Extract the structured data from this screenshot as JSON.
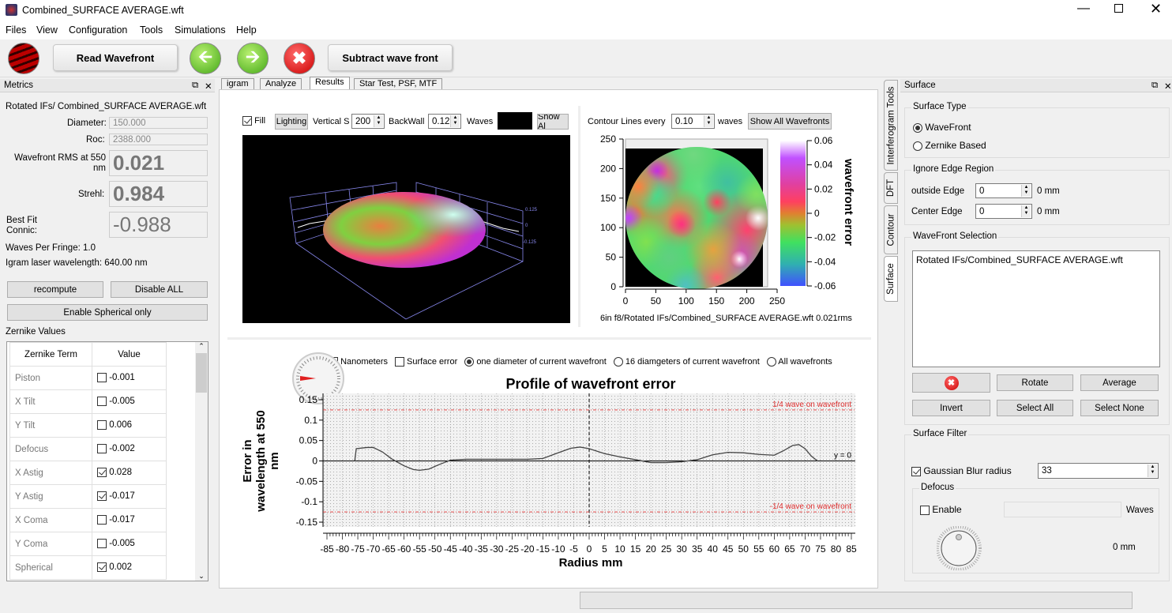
{
  "window": {
    "title": "Combined_SURFACE AVERAGE.wft",
    "controls": [
      "minimize",
      "maximize",
      "close"
    ]
  },
  "menu": [
    "Files",
    "View",
    "Configuration",
    "Tools",
    "Simulations",
    "Help"
  ],
  "toolbar": {
    "read_wavefront": "Read Wavefront",
    "subtract": "Subtract wave front"
  },
  "metrics": {
    "title": "Metrics",
    "file": "Rotated IFs/ Combined_SURFACE AVERAGE.wft",
    "diameter_label": "Diameter:",
    "diameter": "150.000",
    "roc_label": "Roc:",
    "roc": "2388.000",
    "rms_label": "Wavefront RMS at 550 nm",
    "rms": "0.021",
    "strehl_label": "Strehl:",
    "strehl": "0.984",
    "conic_label": "Best Fit Connic:",
    "conic": "-0.988",
    "waves_per_fringe": "Waves Per Fringe: 1.0",
    "laser": "Igram laser wavelength: 640.00 nm",
    "recompute": "recompute",
    "disable_all": "Disable ALL",
    "enable_spherical": "Enable Spherical only",
    "zernike_title": "Zernike Values",
    "zernike_headers": [
      "Zernike Term",
      "Value"
    ],
    "zernike": [
      {
        "term": "Piston",
        "checked": false,
        "value": "-0.001"
      },
      {
        "term": "X Tilt",
        "checked": false,
        "value": "-0.005"
      },
      {
        "term": "Y Tilt",
        "checked": false,
        "value": "0.006"
      },
      {
        "term": "Defocus",
        "checked": false,
        "value": "-0.002"
      },
      {
        "term": "X Astig",
        "checked": true,
        "value": "0.028"
      },
      {
        "term": "Y Astig",
        "checked": true,
        "value": "-0.017"
      },
      {
        "term": "X Coma",
        "checked": false,
        "value": "-0.017"
      },
      {
        "term": "Y Coma",
        "checked": false,
        "value": "-0.005"
      },
      {
        "term": "Spherical",
        "checked": true,
        "value": "0.002"
      }
    ]
  },
  "tabs": [
    "igram",
    "Analyze",
    "Results",
    "Star Test, PSF, MTF"
  ],
  "active_tab": "Results",
  "view3d": {
    "fill_label": "Fill",
    "fill": true,
    "lighting": "Lighting",
    "vertical_label": "Vertical S",
    "vertical": "200",
    "backwall_label": "BackWall",
    "backwall": "0.12",
    "waves_label": "Waves",
    "show_all": "Show Al",
    "axis_labels": [
      "0.125",
      "0",
      "-0.125"
    ]
  },
  "contour": {
    "lines_label": "Contour Lines every",
    "lines": "0.10",
    "waves_label": "waves",
    "show_all": "Show All Wavefronts",
    "x_ticks": [
      "0",
      "50",
      "100",
      "150",
      "200",
      "250"
    ],
    "y_ticks": [
      "0",
      "50",
      "100",
      "150",
      "200",
      "250"
    ],
    "colorbar_ticks": [
      "0.06",
      "0.04",
      "0.02",
      "0",
      "-0.02",
      "-0.04",
      "-0.06"
    ],
    "colorbar_label": "wavefront error",
    "caption": "6in f8/Rotated IFs/Combined_SURFACE AVERAGE.wft  0.021rms"
  },
  "profile": {
    "options": [
      {
        "label": "Nanometers",
        "type": "check",
        "on": false
      },
      {
        "label": "Surface error",
        "type": "check",
        "on": false
      },
      {
        "label": "one diameter of current wavefront",
        "type": "radio",
        "on": true
      },
      {
        "label": "16 diamgeters of current wavefront",
        "type": "radio",
        "on": false
      },
      {
        "label": "All wavefronts",
        "type": "radio",
        "on": false
      }
    ]
  },
  "chart_data": {
    "type": "line",
    "title": "Profile of wavefront error",
    "xlabel": "Radius mm",
    "ylabel": "Error in wavelength at 550 nm",
    "xlim": [
      -85,
      85
    ],
    "ylim": [
      -0.15,
      0.15
    ],
    "x_ticks": [
      "-85",
      "-80",
      "-75",
      "-70",
      "-65",
      "-60",
      "-55",
      "-50",
      "-45",
      "-40",
      "-35",
      "-30",
      "-25",
      "-20",
      "-15",
      "-10",
      "-5",
      "0",
      "5",
      "10",
      "15",
      "20",
      "25",
      "30",
      "35",
      "40",
      "45",
      "50",
      "55",
      "60",
      "65",
      "70",
      "75",
      "80",
      "85"
    ],
    "y_ticks": [
      "0.15",
      "0.1",
      "0.05",
      "0",
      "-0.05",
      "-0.1",
      "-0.15"
    ],
    "grid": true,
    "x": [
      -76,
      -75.5,
      -72,
      -70,
      -67,
      -64,
      -60,
      -57,
      -55,
      -52,
      -49,
      -45,
      -40,
      -30,
      -20,
      -15,
      -10,
      -6,
      -3,
      0,
      5,
      10,
      15,
      20,
      25,
      30,
      35,
      40,
      45,
      50,
      55,
      60,
      63,
      66,
      68,
      70,
      72,
      74
    ],
    "y": [
      0,
      0.03,
      0.033,
      0.033,
      0.022,
      0.005,
      -0.012,
      -0.021,
      -0.023,
      -0.02,
      -0.01,
      0.002,
      0.004,
      0.004,
      0.004,
      0.006,
      0.02,
      0.031,
      0.034,
      0.03,
      0.018,
      0.01,
      0.003,
      -0.004,
      -0.004,
      -0.002,
      0.003,
      0.015,
      0.021,
      0.02,
      0.016,
      0.014,
      0.025,
      0.038,
      0.04,
      0.03,
      0.012,
      0
    ],
    "reference_lines": [
      {
        "y": 0.125,
        "label": "1/4 wave on wavefront",
        "color": "#e03030"
      },
      {
        "y": -0.125,
        "label": "-1/4 wave on wavefront",
        "color": "#e03030"
      },
      {
        "y": 0,
        "label": "y = 0",
        "color": "#000000"
      }
    ]
  },
  "surface": {
    "title": "Surface",
    "side_tabs": [
      "Interferogram Tools",
      "DFT",
      "Contour",
      "Surface"
    ],
    "type_title": "Surface Type",
    "type_options": [
      "WaveFront",
      "Zernike Based"
    ],
    "type_selected": "WaveFront",
    "edge_title": "Ignore Edge Region",
    "outside_label": "outside Edge",
    "outside": "0",
    "outside_unit": "0 mm",
    "center_label": "Center Edge",
    "center": "0",
    "center_unit": "0 mm",
    "selection_title": "WaveFront Selection",
    "selection_items": [
      "Rotated IFs/Combined_SURFACE AVERAGE.wft"
    ],
    "rotate": "Rotate",
    "average": "Average",
    "invert": "Invert",
    "select_all": "Select All",
    "select_none": "Select None",
    "filter_title": "Surface Filter",
    "gaussian_label": "Gaussian Blur radius",
    "gaussian_on": true,
    "gaussian": "33",
    "defocus_title": "Defocus",
    "enable_label": "Enable",
    "enable_on": false,
    "waves_label": "Waves",
    "defocus_mm": "0  mm"
  },
  "colors": {
    "accent_red": "#d42020",
    "accent_green": "#4cb82c",
    "ref_line": "#e03030"
  }
}
